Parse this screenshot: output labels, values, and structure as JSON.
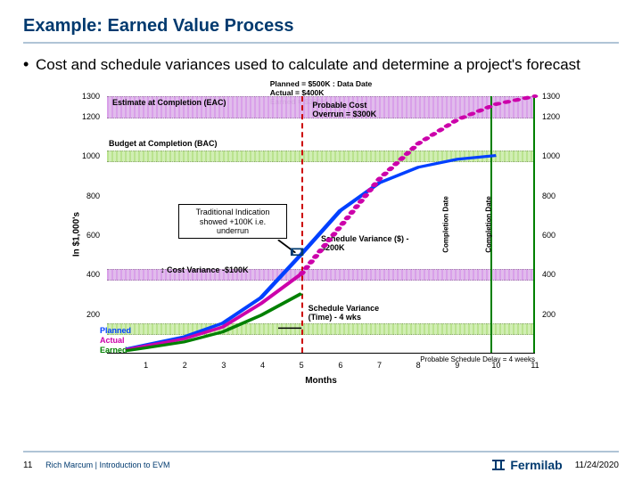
{
  "title": "Example: Earned Value Process",
  "bullet": "Cost and schedule variances used to calculate and determine a project's forecast",
  "footer": {
    "page": "11",
    "author": "Rich Marcum | Introduction to EVM",
    "date": "11/24/2020",
    "logo": "Fermilab"
  },
  "chart_data": {
    "type": "line",
    "title": "",
    "ylabel": "In $1,000's",
    "xlabel": "Months",
    "ylim": [
      0,
      1300
    ],
    "xlim": [
      0,
      11
    ],
    "x_ticks": [
      1,
      2,
      3,
      4,
      5,
      6,
      7,
      8,
      9,
      10,
      11
    ],
    "y_ticks": [
      200,
      400,
      600,
      800,
      1000,
      1200,
      1300
    ],
    "y_ticks_right": [
      200,
      400,
      600,
      800,
      1000,
      1200,
      1300
    ],
    "header": [
      "Planned  = $500K",
      "Actual    = $400K",
      "Earned   = $300K",
      "Data Date"
    ],
    "data_date_x": 5,
    "bands": [
      {
        "name": "EAC",
        "from": 1200,
        "to": 1300,
        "color": "purple",
        "label": "Estimate at Completion (EAC)"
      },
      {
        "name": "BAC",
        "from": 975,
        "to": 1025,
        "color": "green",
        "label": "Budget at Completion (BAC)"
      },
      {
        "name": "CV",
        "from": 375,
        "to": 425,
        "color": "purple",
        "label": "Cost Variance -$100K"
      },
      {
        "name": "SV",
        "from": 100,
        "to": 150,
        "color": "green",
        "label": "Schedule Variance (Time) - 4 wks"
      }
    ],
    "series": [
      {
        "name": "Planned",
        "color": "#0040ff",
        "values": [
          [
            0.5,
            20
          ],
          [
            1,
            40
          ],
          [
            2,
            80
          ],
          [
            3,
            150
          ],
          [
            4,
            280
          ],
          [
            5,
            500
          ],
          [
            6,
            720
          ],
          [
            7,
            860
          ],
          [
            8,
            940
          ],
          [
            9,
            980
          ],
          [
            10,
            1000
          ]
        ]
      },
      {
        "name": "Actual",
        "color": "#cc00aa",
        "style": "solid",
        "values": [
          [
            0.5,
            15
          ],
          [
            1,
            35
          ],
          [
            2,
            70
          ],
          [
            3,
            130
          ],
          [
            4,
            250
          ],
          [
            5,
            400
          ]
        ]
      },
      {
        "name": "Actual-fcst",
        "color": "#cc00aa",
        "style": "dotted",
        "values": [
          [
            5,
            400
          ],
          [
            6,
            640
          ],
          [
            7,
            880
          ],
          [
            8,
            1060
          ],
          [
            9,
            1180
          ],
          [
            10,
            1260
          ],
          [
            11,
            1300
          ]
        ]
      },
      {
        "name": "Earned",
        "color": "#008000",
        "values": [
          [
            0.5,
            10
          ],
          [
            1,
            25
          ],
          [
            2,
            55
          ],
          [
            3,
            105
          ],
          [
            4,
            190
          ],
          [
            5,
            300
          ]
        ]
      }
    ],
    "annotations": {
      "traditional": "Traditional Indication showed +100K i.e. underrun",
      "cost_overrun": "Probable Cost Overrun = $300K",
      "sv_dollars": "Schedule Variance ($) - $200K",
      "completion_date": "Completion Date",
      "completion_duration": "Completion Date",
      "delay": "Probable Schedule Delay = 4 weeks"
    }
  }
}
